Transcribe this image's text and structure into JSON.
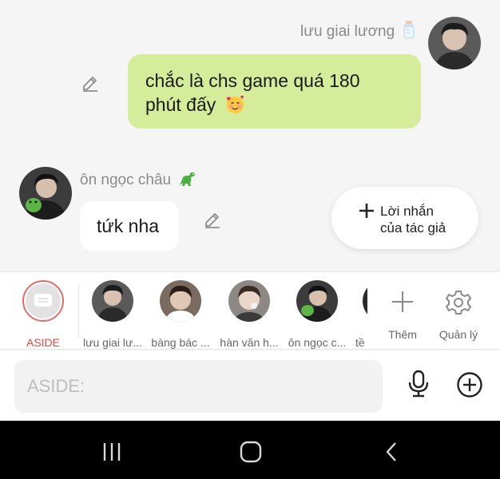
{
  "messages": {
    "outgoing": {
      "sender": "lưu giai lương",
      "text_line1": "chắc là chs game quá 180",
      "text_line2": "phút đấy"
    },
    "incoming": {
      "sender": "ôn ngọc châu",
      "text": "tứk nha"
    }
  },
  "author_note": {
    "line1": "Lời nhắn",
    "line2": "của tác giả"
  },
  "characters": [
    {
      "label": "ASIDE"
    },
    {
      "label": "lưu giai lư..."
    },
    {
      "label": "bàng bác ..."
    },
    {
      "label": "hàn văn h..."
    },
    {
      "label": "ôn ngọc c..."
    },
    {
      "label": "tề"
    }
  ],
  "actions": {
    "add_label": "Thêm",
    "manage_label": "Quản lý"
  },
  "input": {
    "placeholder": "ASIDE:"
  },
  "icons": {
    "edit": "pencil-icon",
    "add": "plus-icon",
    "settings": "gear-icon",
    "mic": "microphone-icon",
    "add_circle": "plus-circle-icon",
    "nav_recent": "recent-apps-icon",
    "nav_home": "home-icon",
    "nav_back": "back-icon"
  },
  "colors": {
    "outgoing_bubble": "#d5ed9a",
    "incoming_bubble": "#ffffff",
    "aside_accent": "#e0483f"
  }
}
